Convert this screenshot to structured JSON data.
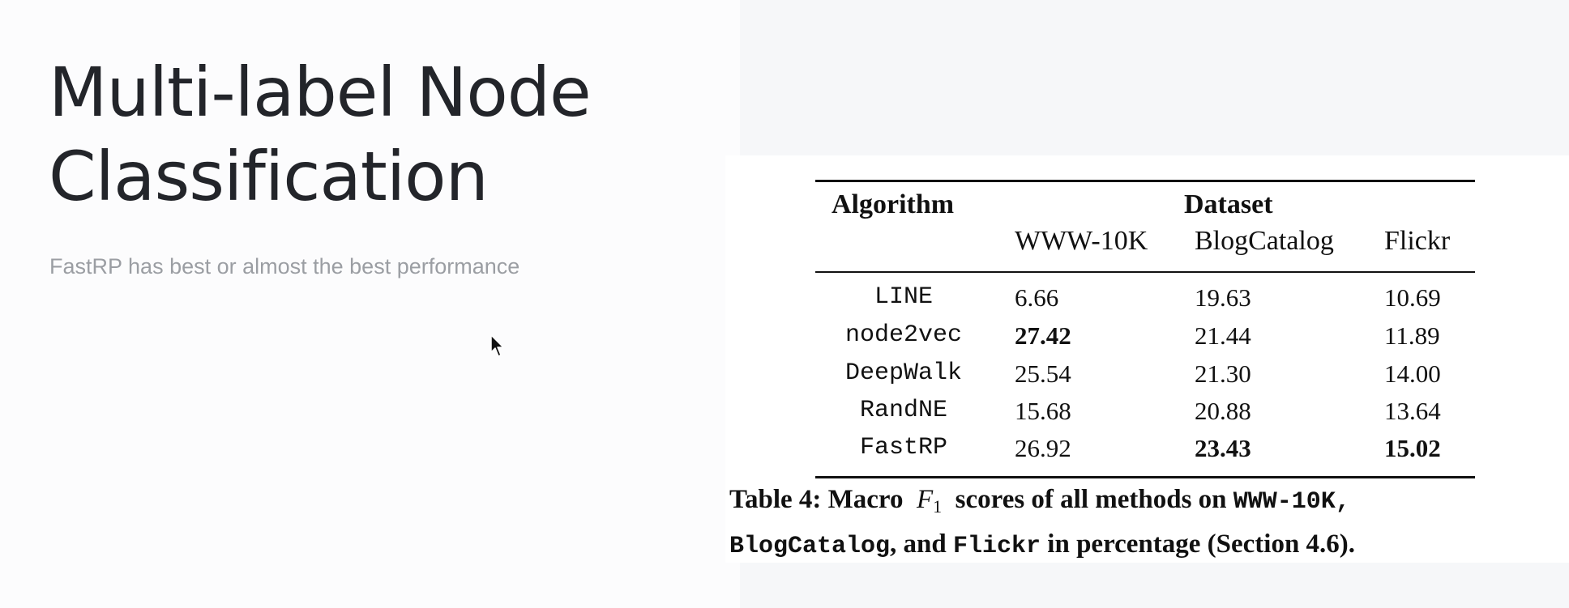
{
  "slide": {
    "title_line1": "Multi-label Node",
    "title_line2": "Classification",
    "subtitle": "FastRP has best or almost the best performance"
  },
  "table": {
    "header_algorithm": "Algorithm",
    "header_dataset": "Dataset",
    "columns": [
      "WWW-10K",
      "BlogCatalog",
      "Flickr"
    ],
    "rows": [
      {
        "algorithm": "LINE",
        "values": [
          "6.66",
          "19.63",
          "10.69"
        ],
        "bold": [
          false,
          false,
          false
        ]
      },
      {
        "algorithm": "node2vec",
        "values": [
          "27.42",
          "21.44",
          "11.89"
        ],
        "bold": [
          true,
          false,
          false
        ]
      },
      {
        "algorithm": "DeepWalk",
        "values": [
          "25.54",
          "21.30",
          "14.00"
        ],
        "bold": [
          false,
          false,
          false
        ]
      },
      {
        "algorithm": "RandNE",
        "values": [
          "15.68",
          "20.88",
          "13.64"
        ],
        "bold": [
          false,
          false,
          false
        ]
      },
      {
        "algorithm": "FastRP",
        "values": [
          "26.92",
          "23.43",
          "15.02"
        ],
        "bold": [
          false,
          true,
          true
        ]
      }
    ]
  },
  "caption": {
    "prefix": "Table 4: Macro",
    "f": "F",
    "f_sub": "1",
    "middle": "scores of all methods on",
    "ds1": "WWW-10K,",
    "ds2": "BlogCatalog",
    "and": ", and",
    "ds3": "Flickr",
    "suffix": "in percentage (Section 4.6)."
  }
}
